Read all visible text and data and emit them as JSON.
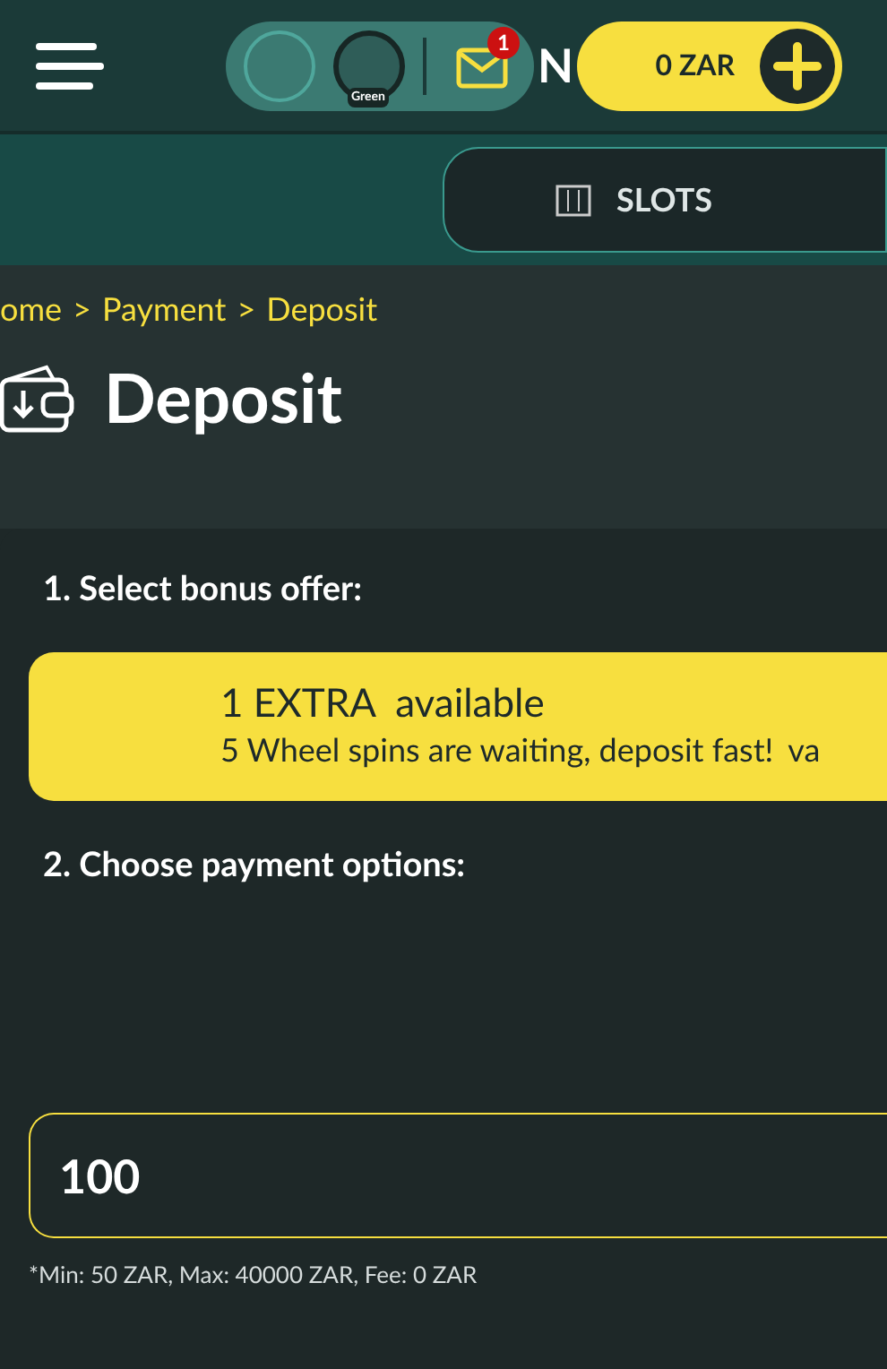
{
  "header": {
    "themes": [
      {
        "selected": false
      },
      {
        "label": "Green",
        "selected": true
      }
    ],
    "mail_badge": "1",
    "logo_text": "N",
    "balance": "0 ZAR"
  },
  "nav": {
    "tabs": [
      {
        "label": "SLOTS",
        "selected": true
      }
    ]
  },
  "breadcrumbs": [
    "ome",
    "Payment",
    "Deposit"
  ],
  "breadcrumb_separator": ">",
  "page_title": "Deposit",
  "steps": [
    {
      "title": "1. Select bonus offer:"
    },
    {
      "title": "2. Choose payment options:"
    }
  ],
  "bonus": {
    "title": "1 EXTRA  available",
    "description": "5 Wheel spins are waiting, deposit fast!",
    "extra": "va"
  },
  "amount": {
    "value": "100",
    "hint": "*Min: 50 ZAR, Max: 40000 ZAR, Fee: 0 ZAR"
  }
}
